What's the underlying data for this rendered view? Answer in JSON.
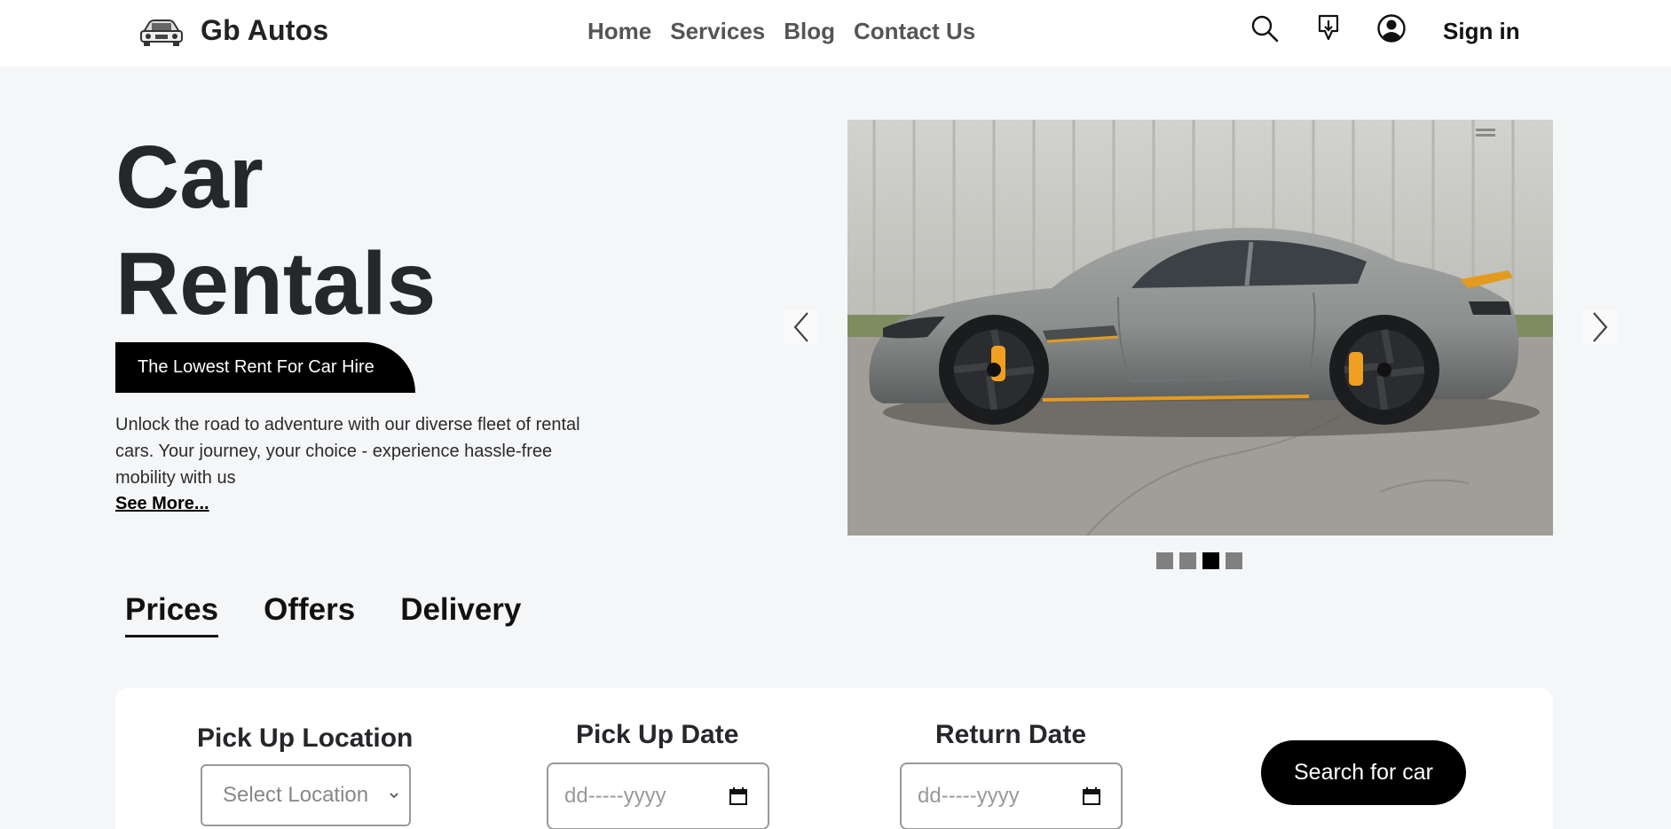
{
  "header": {
    "brand_name": "Gb Autos",
    "nav": [
      "Home",
      "Services",
      "Blog",
      "Contact Us"
    ],
    "signin_label": "Sign in",
    "icons": [
      "search-icon",
      "download-icon",
      "user-account-icon"
    ]
  },
  "hero": {
    "title_line1": "Car",
    "title_line2": "Rentals",
    "tagline": "The Lowest Rent For Car Hire",
    "description": "Unlock the road to adventure with our diverse fleet of rental cars. Your journey, your choice - experience hassle-free mobility with us",
    "see_more": "See More..."
  },
  "carousel": {
    "slide_count": 4,
    "active_slide": 3,
    "image": "grey-sports-car-photo"
  },
  "tabs": {
    "items": [
      "Prices",
      "Offers",
      "Delivery"
    ],
    "active": "Prices"
  },
  "search": {
    "pickup_location_label": "Pick Up Location",
    "pickup_location_placeholder": "Select Location",
    "pickup_date_label": "Pick Up Date",
    "pickup_date_placeholder": "dd-----yyyy",
    "return_date_label": "Return Date",
    "return_date_placeholder": "dd-----yyyy",
    "button_label": "Search for car"
  },
  "colors": {
    "background": "#f5f6f8",
    "header": "#ffffff",
    "accent": "#000000",
    "nav_text": "#555555"
  }
}
